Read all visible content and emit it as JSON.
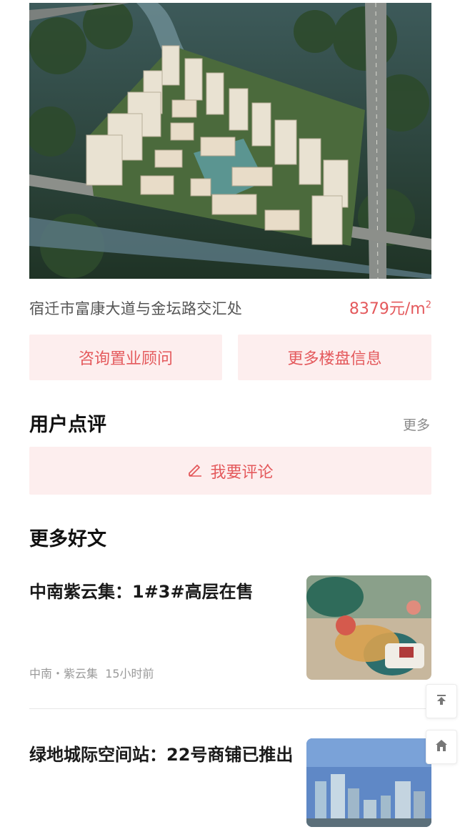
{
  "project": {
    "address": "宿迁市富康大道与金坛路交汇处",
    "price": "8379元/m",
    "price_unit_sup": "2"
  },
  "actions": {
    "consult": "咨询置业顾问",
    "more_info": "更多楼盘信息"
  },
  "reviews": {
    "title": "用户点评",
    "more": "更多",
    "write": "我要评论"
  },
  "articles_section": {
    "title": "更多好文",
    "items": [
      {
        "title": "中南紫云集：1#3#高层在售",
        "source": "中南・紫云集",
        "time": "15小时前"
      },
      {
        "title": "绿地城际空间站：22号商铺已推出"
      }
    ]
  },
  "icons": {
    "edit": "edit-icon",
    "back_to_top": "back-to-top-icon",
    "home": "home-icon"
  },
  "colors": {
    "accent": "#e4595c",
    "accent_bg": "#fdeeee"
  }
}
